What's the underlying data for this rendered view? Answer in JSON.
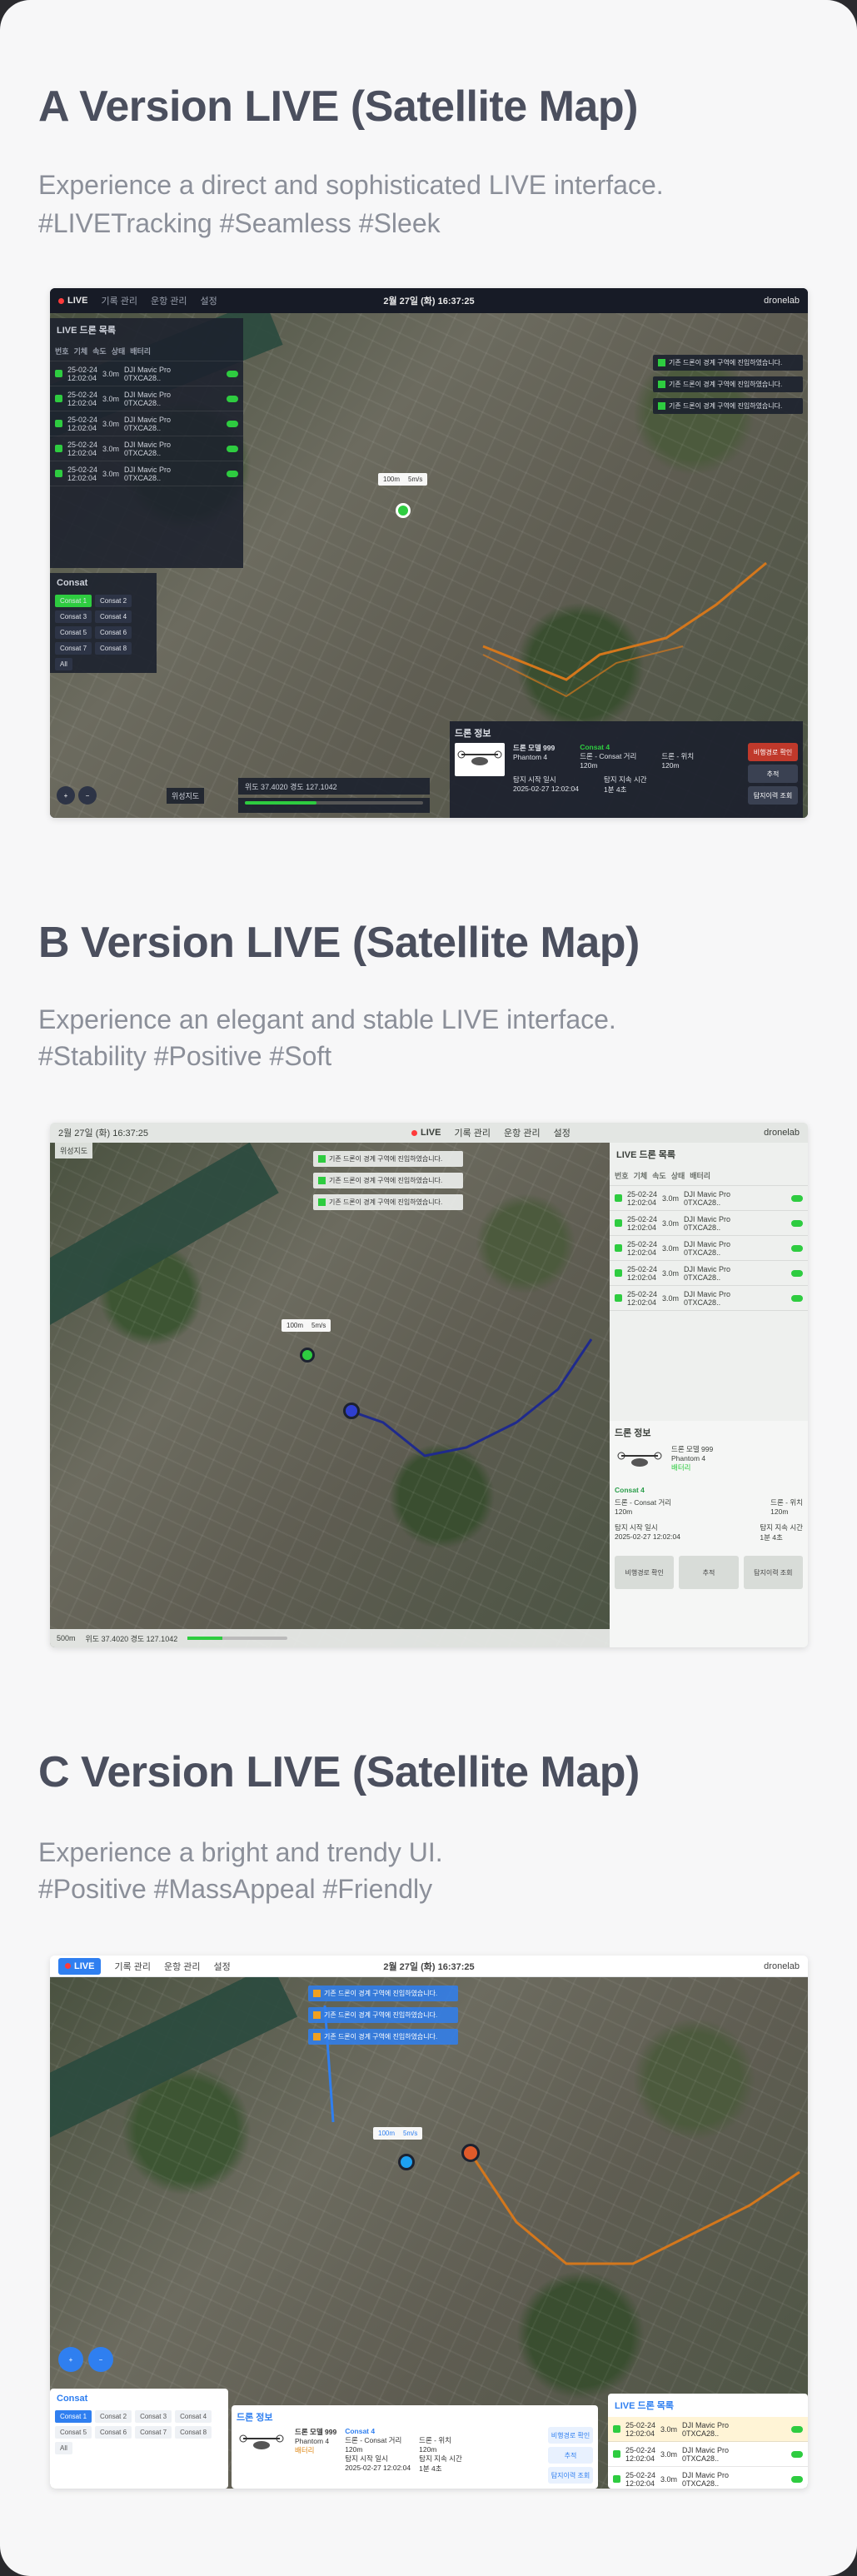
{
  "sections": [
    {
      "title": "A Version LIVE (Satellite Map)",
      "desc1": "Experience a direct and sophisticated LIVE interface.",
      "desc2": "#LIVETracking  #Seamless  #Sleek"
    },
    {
      "title": "B Version LIVE (Satellite Map)",
      "desc1": "Experience an elegant and stable LIVE interface.",
      "desc2": "#Stability #Positive #Soft"
    },
    {
      "title": "C Version LIVE (Satellite Map)",
      "desc1": "Experience a bright and trendy UI.",
      "desc2": "#Positive #MassAppeal #Friendly"
    }
  ],
  "ui": {
    "live": "LIVE",
    "nav": [
      "기록 관리",
      "운항 관리",
      "설정"
    ],
    "datetime": "2월 27일 (화) 16:37:25",
    "user": "dronelab",
    "list_title": "LIVE 드론 목록",
    "list_headers": [
      "번호",
      "기체",
      "속도",
      "상태",
      "배터리"
    ],
    "rows": [
      {
        "date": "25-02-24",
        "time": "12:02:04",
        "speed": "3.0m",
        "model": "DJI Mavic Pro",
        "serial": "0TXCA28.."
      },
      {
        "date": "25-02-24",
        "time": "12:02:04",
        "speed": "3.0m",
        "model": "DJI Mavic Pro",
        "serial": "0TXCA28.."
      },
      {
        "date": "25-02-24",
        "time": "12:02:04",
        "speed": "3.0m",
        "model": "DJI Mavic Pro",
        "serial": "0TXCA28.."
      },
      {
        "date": "25-02-24",
        "time": "12:02:04",
        "speed": "3.0m",
        "model": "DJI Mavic Pro",
        "serial": "0TXCA28.."
      },
      {
        "date": "25-02-24",
        "time": "12:02:04",
        "speed": "3.0m",
        "model": "DJI Mavic Pro",
        "serial": "0TXCA28.."
      }
    ],
    "consat_title": "Consat",
    "consat_items": [
      "Consat 1",
      "Consat 2",
      "Consat 3",
      "Consat 4",
      "Consat 5",
      "Consat 6",
      "Consat 7",
      "Consat 8",
      "All"
    ],
    "alerts": [
      "기존 드론이 경계 구역에 진입하였습니다.",
      "기존 드론이 경계 구역에 진입하였습니다.",
      "기존 드론이 경계 구역에 진입하였습니다."
    ],
    "popup": {
      "alt": "100m",
      "speed": "5m/s"
    },
    "info_title": "드론 정보",
    "drone_name": "드론 모델 999",
    "drone_sub": "Phantom 4",
    "consat_label": "Consat 4",
    "f1_label": "드론 - Consat 거리",
    "f1_value": "120m",
    "f2_label": "드론 - 위치",
    "f2_value": "120m",
    "f3_label": "탐지 시작 일시",
    "f3_value": "2025-02-27 12:02:04",
    "f4_label": "탐지 지속 시간",
    "f4_value": "1분 4초",
    "battery": "배터리",
    "btn1": "비행경로 확인",
    "btn2": "추적",
    "btn3": "탐지이력 조회",
    "coords": "위도 37.4020 경도 127.1042",
    "scale": "500m",
    "map_type": "위성지도"
  },
  "colors": {
    "dark": "#1d2230",
    "green": "#2ecc40",
    "blue": "#2f7ff0",
    "route_orange": "#d4771c",
    "route_navy": "#1f2a8c"
  }
}
